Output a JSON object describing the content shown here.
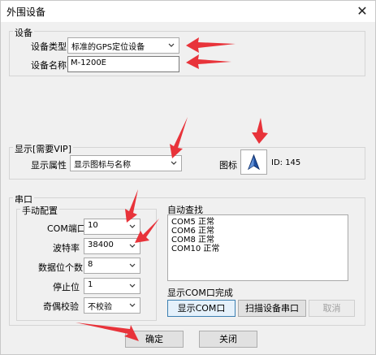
{
  "window": {
    "title": "外围设备",
    "close_glyph": "✕"
  },
  "device": {
    "group_label": "设备",
    "type_label": "设备类型",
    "type_value": "标准的GPS定位设备",
    "name_label": "设备名称",
    "name_value": "M-1200E"
  },
  "display": {
    "group_label": "显示[需要VIP]",
    "attr_label": "显示属性",
    "attr_value": "显示图标与名称",
    "icon_label": "图标",
    "icon_id": "ID: 145"
  },
  "serial": {
    "group_label": "串口",
    "manual": {
      "group_label": "手动配置",
      "com_label": "COM端口",
      "com_value": "10",
      "baud_label": "波特率",
      "baud_value": "38400",
      "databits_label": "数据位个数",
      "databits_value": "8",
      "stopbits_label": "停止位",
      "stopbits_value": "1",
      "parity_label": "奇偶校验",
      "parity_value": "不校验"
    },
    "auto": {
      "group_label": "自动查找",
      "ports": [
        "COM5 正常",
        "COM6 正常",
        "COM8 正常",
        "COM10 正常"
      ],
      "status": "显示COM口完成",
      "show_button": "显示COM口",
      "scan_button": "扫描设备串口",
      "cancel_button": "取消"
    }
  },
  "footer": {
    "ok_button": "确定",
    "close_button": "关闭"
  },
  "colors": {
    "annotation_arrow": "#e8333a",
    "icon_arrow": "#1e4fa0"
  }
}
